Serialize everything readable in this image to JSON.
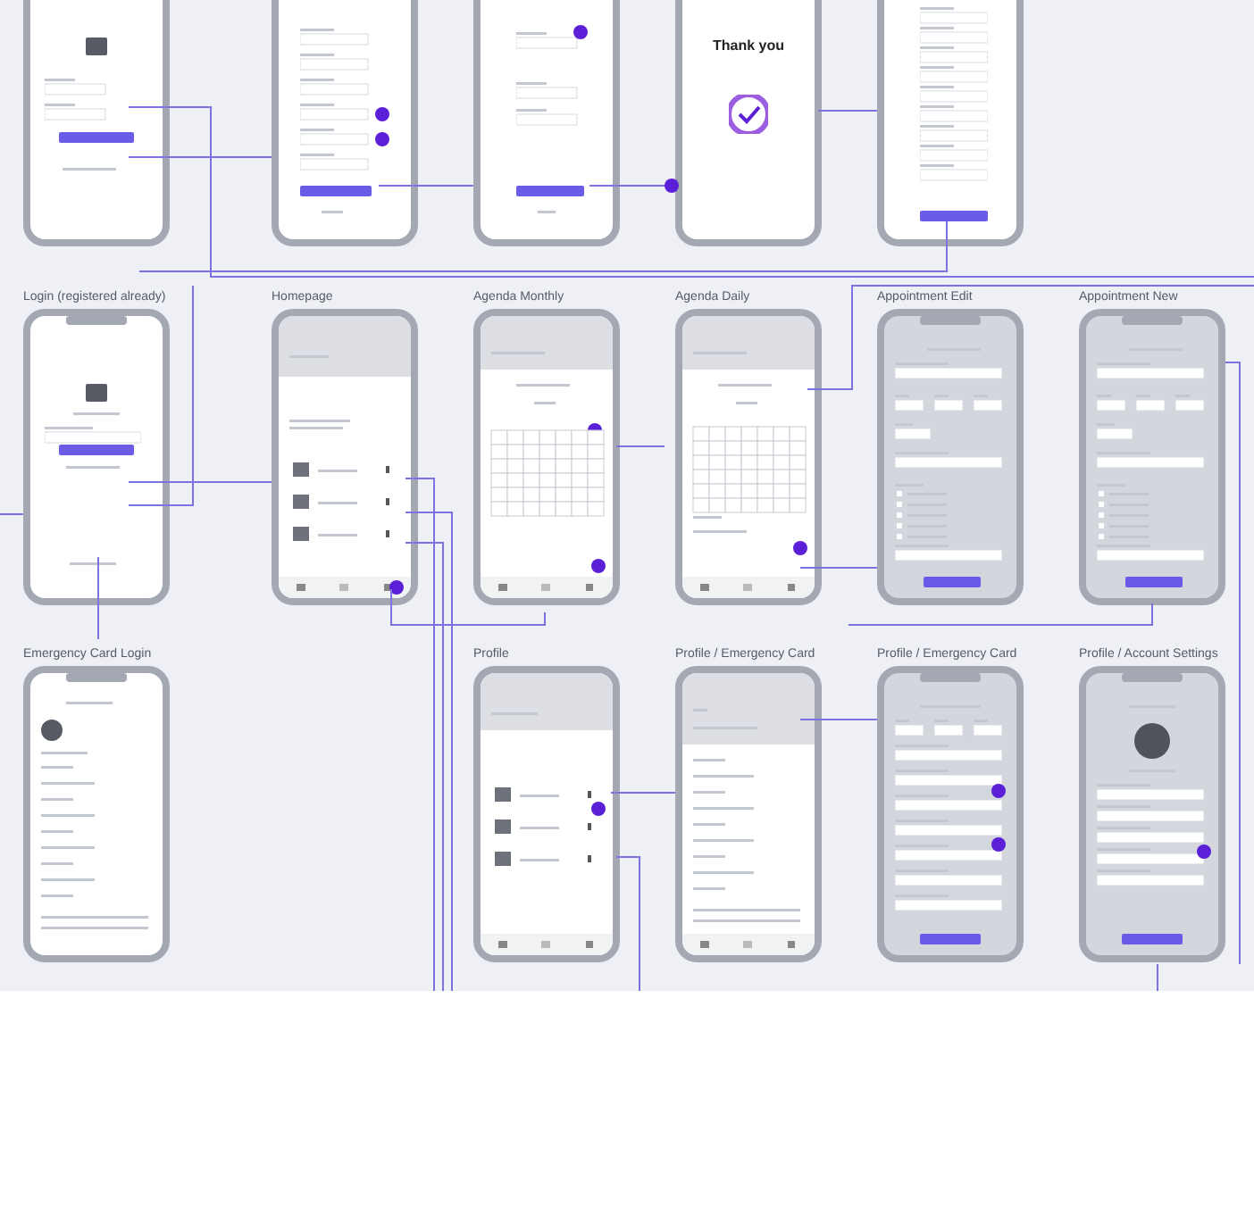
{
  "screens": [
    {
      "kind": "login"
    },
    {
      "kind": "signup_form"
    },
    {
      "kind": "short_form"
    },
    {
      "kind": "thanks",
      "heading": "Thank you"
    },
    {
      "kind": "long_form"
    },
    {
      "kind": "empty"
    },
    {
      "kind": "login_return",
      "title": "Login (registered already)"
    },
    {
      "kind": "home",
      "title": "Homepage"
    },
    {
      "kind": "calendar",
      "title": "Agenda Monthly"
    },
    {
      "kind": "calendar_daily",
      "title": "Agenda Daily"
    },
    {
      "kind": "appointment_form",
      "title": "Appointment Edit"
    },
    {
      "kind": "appointment_form",
      "title": "Appointment New"
    },
    {
      "kind": "emergency_card",
      "title": "Emergency Card Login"
    },
    {
      "kind": "empty"
    },
    {
      "kind": "profile",
      "title": "Profile"
    },
    {
      "kind": "emergency_summary",
      "title": "Profile / Emergency Card"
    },
    {
      "kind": "emergency_form",
      "title": "Profile / Emergency Card"
    },
    {
      "kind": "account_form",
      "title": "Profile / Account Settings"
    }
  ]
}
